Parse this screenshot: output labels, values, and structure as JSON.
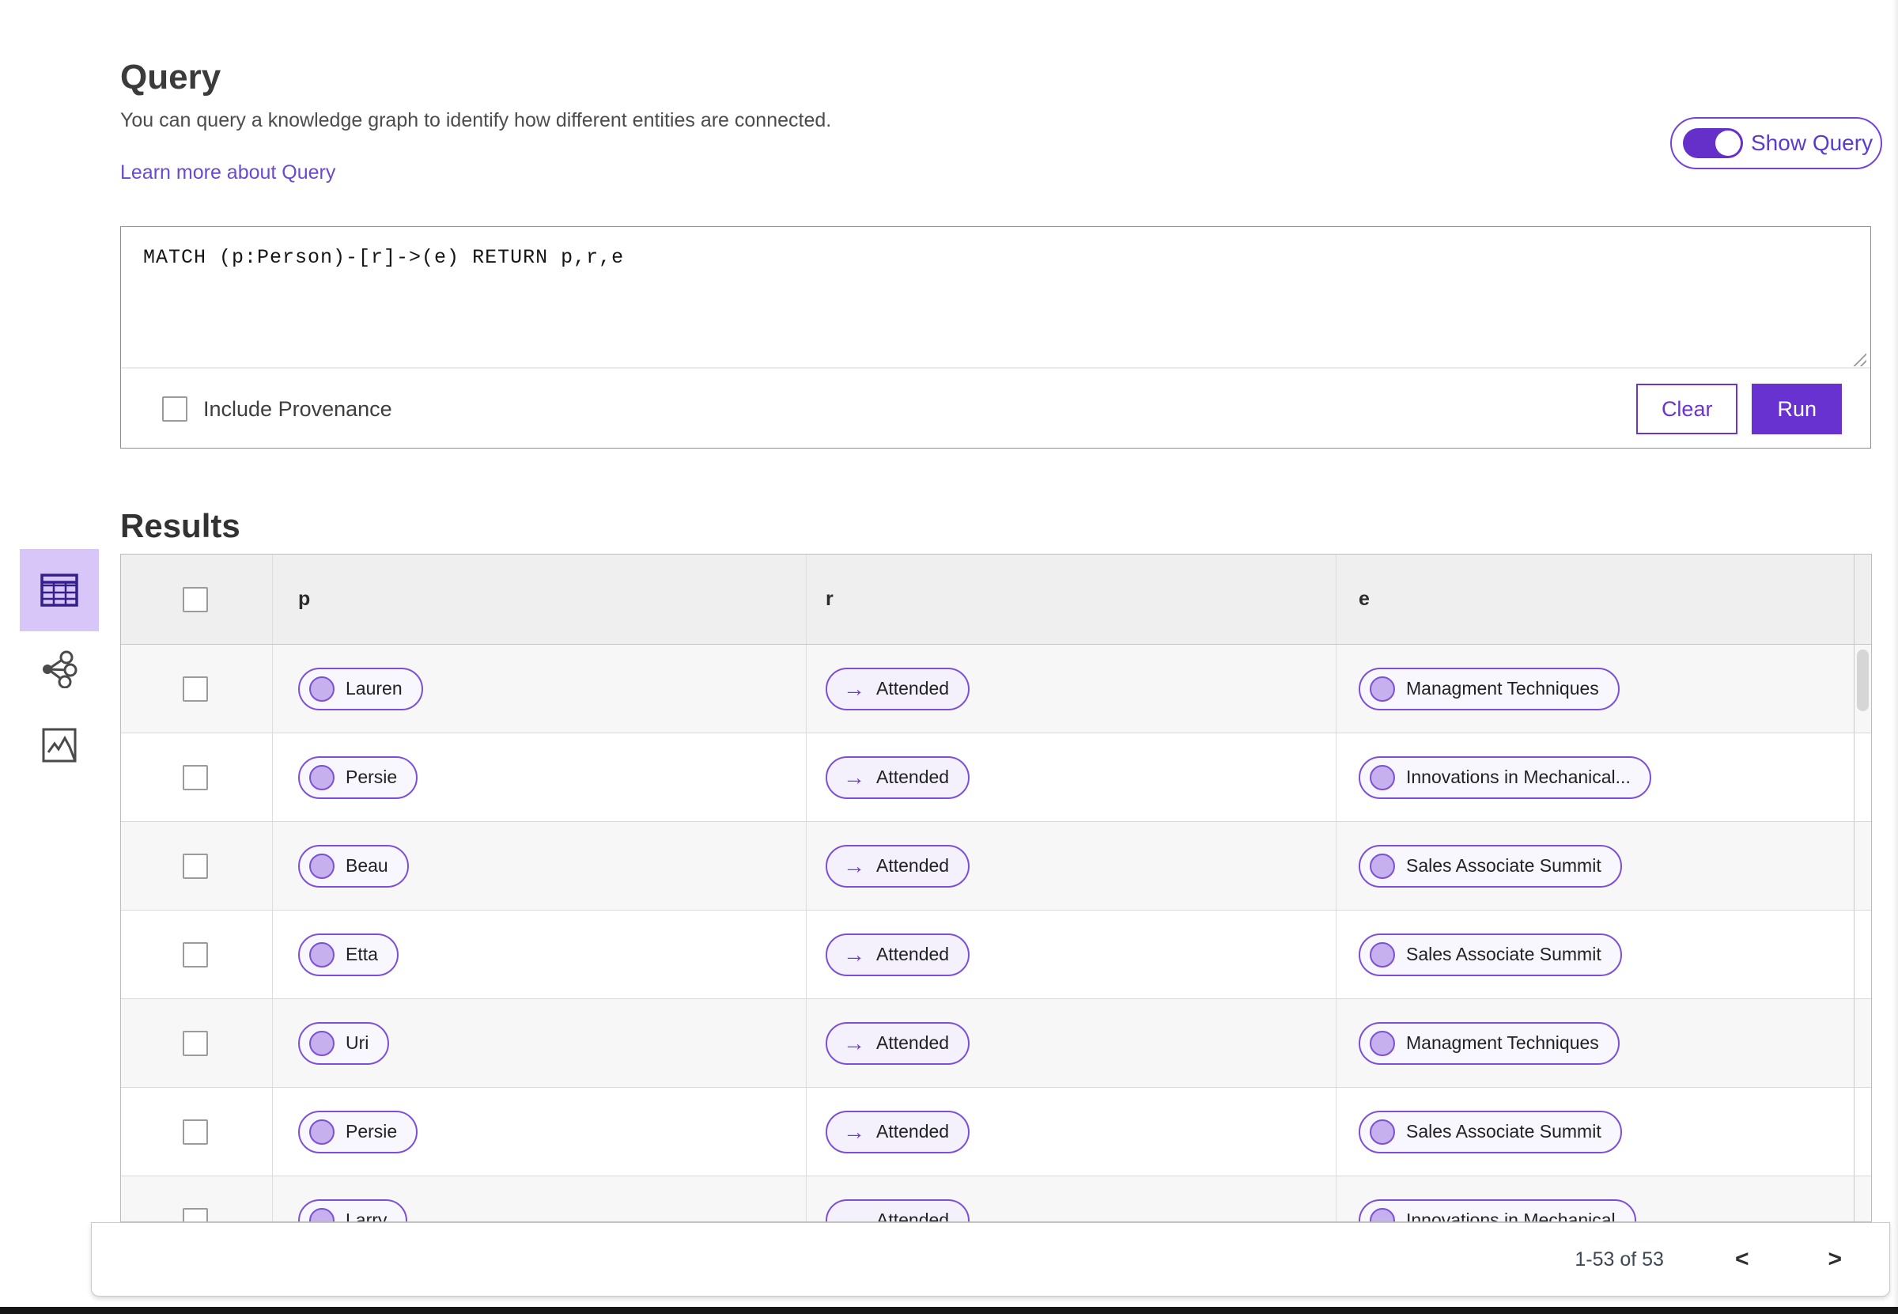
{
  "header": {
    "title": "Query",
    "description": "You can query a knowledge graph to identify how different entities are connected.",
    "learn_more": "Learn more about Query",
    "show_query_label": "Show Query",
    "show_query_on": true
  },
  "query_panel": {
    "query_text": "MATCH (p:Person)-[r]->(e) RETURN p,r,e",
    "include_provenance_label": "Include Provenance",
    "include_provenance_checked": false,
    "clear_label": "Clear",
    "run_label": "Run"
  },
  "results": {
    "title": "Results",
    "view_modes": [
      "table",
      "link-chart",
      "chart"
    ],
    "selected_view": "table",
    "columns": [
      "p",
      "r",
      "e"
    ],
    "rows": [
      {
        "p": "Lauren",
        "r": "Attended",
        "e": "Managment Techniques"
      },
      {
        "p": "Persie",
        "r": "Attended",
        "e": "Innovations in Mechanical..."
      },
      {
        "p": "Beau",
        "r": "Attended",
        "e": "Sales Associate Summit"
      },
      {
        "p": "Etta",
        "r": "Attended",
        "e": "Sales Associate Summit"
      },
      {
        "p": "Uri",
        "r": "Attended",
        "e": "Managment Techniques"
      },
      {
        "p": "Persie",
        "r": "Attended",
        "e": "Sales Associate Summit"
      },
      {
        "p": "Larry",
        "r": "Attended",
        "e": "Innovations in Mechanical"
      }
    ],
    "pagination": {
      "range_label": "1-53 of 53"
    }
  },
  "icons": {
    "arrow_right": "→",
    "chevron_left": "<",
    "chevron_right": ">"
  },
  "colors": {
    "primary_purple": "#6732cf",
    "pill_border": "#7b50d6",
    "pill_dot_fill": "#c6b0ee",
    "selected_view_bg": "#d9c6f8",
    "link_purple": "#6a4ad0",
    "table_header_bg": "#efefef",
    "odd_row_bg": "#f7f7f7"
  }
}
